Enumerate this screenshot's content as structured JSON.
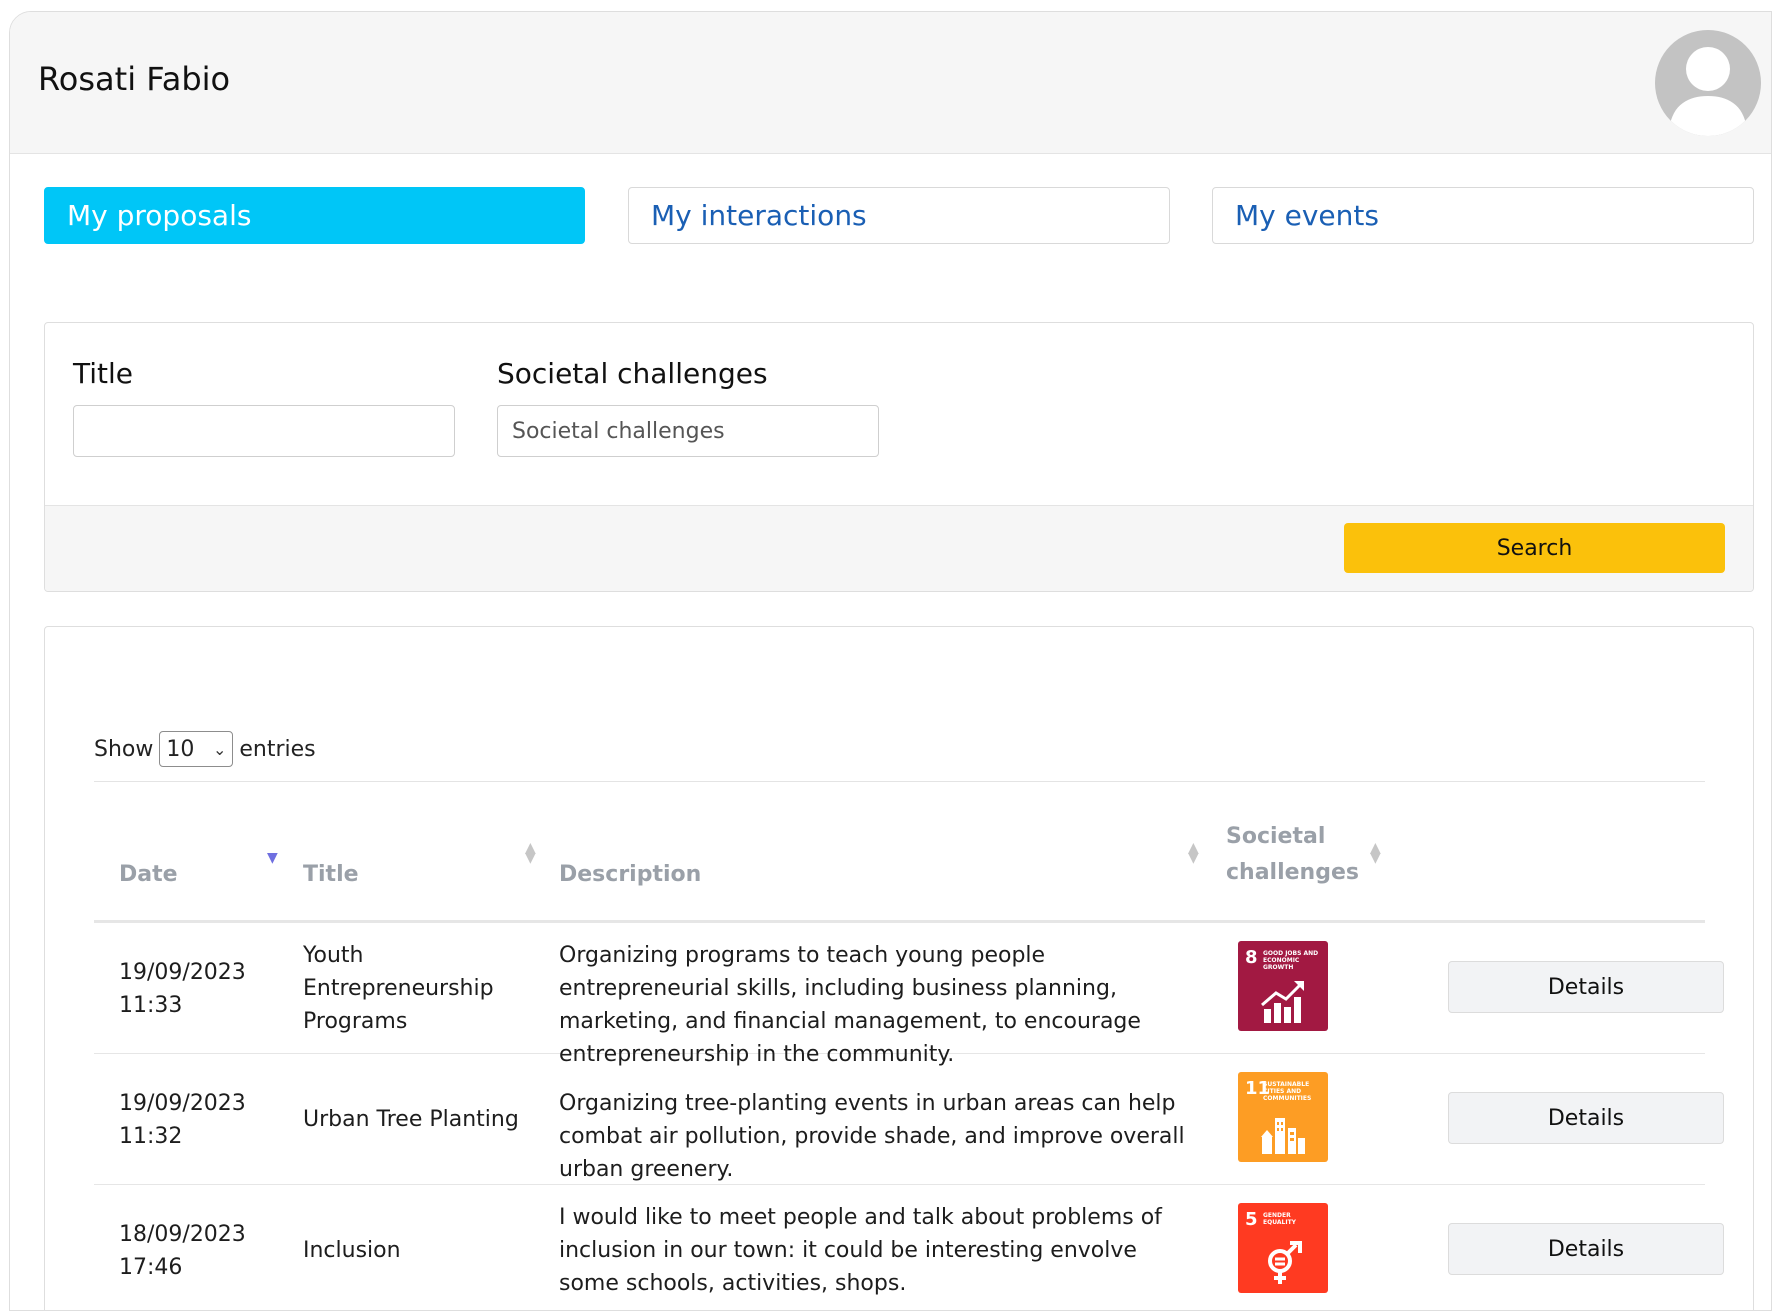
{
  "header": {
    "user_name": "Rosati Fabio"
  },
  "tabs": [
    {
      "label": "My proposals",
      "active": true
    },
    {
      "label": "My interactions",
      "active": false
    },
    {
      "label": "My events",
      "active": false
    }
  ],
  "filters": {
    "title_label": "Title",
    "title_value": "",
    "challenges_label": "Societal challenges",
    "challenges_placeholder": "Societal challenges",
    "search_label": "Search"
  },
  "table": {
    "show_label": "Show",
    "entries_value": "10",
    "entries_label": "entries",
    "columns": {
      "date": "Date",
      "title": "Title",
      "description": "Description",
      "challenges_line1": "Societal",
      "challenges_line2": "challenges"
    },
    "rows": [
      {
        "date": "19/09/2023",
        "time": "11:33",
        "title": "Youth Entrepreneurship Programs",
        "description": "Organizing programs to teach young people entrepreneurial skills, including business planning, marketing, and financial management, to encourage entrepreneurship in the community.",
        "sdg_number": "8",
        "sdg_text": "GOOD JOBS AND ECONOMIC GROWTH",
        "sdg_color": "#a21942",
        "details_label": "Details"
      },
      {
        "date": "19/09/2023",
        "time": "11:32",
        "title": "Urban Tree Planting",
        "description": "Organizing tree-planting events in urban areas can help combat air pollution, provide shade, and improve overall urban greenery.",
        "sdg_number": "11",
        "sdg_text": "SUSTAINABLE CITIES AND COMMUNITIES",
        "sdg_color": "#fd9d24",
        "details_label": "Details"
      },
      {
        "date": "18/09/2023",
        "time": "17:46",
        "title": "Inclusion",
        "description": "I would like to meet people and talk about problems of inclusion in our town: it could be interesting envolve some schools, activities, shops.",
        "sdg_number": "5",
        "sdg_text": "GENDER EQUALITY",
        "sdg_color": "#ff3a21",
        "details_label": "Details"
      }
    ]
  },
  "colors": {
    "active_tab": "#00c6f7",
    "tab_text": "#1a5fb4",
    "search_button": "#fbc10b"
  }
}
